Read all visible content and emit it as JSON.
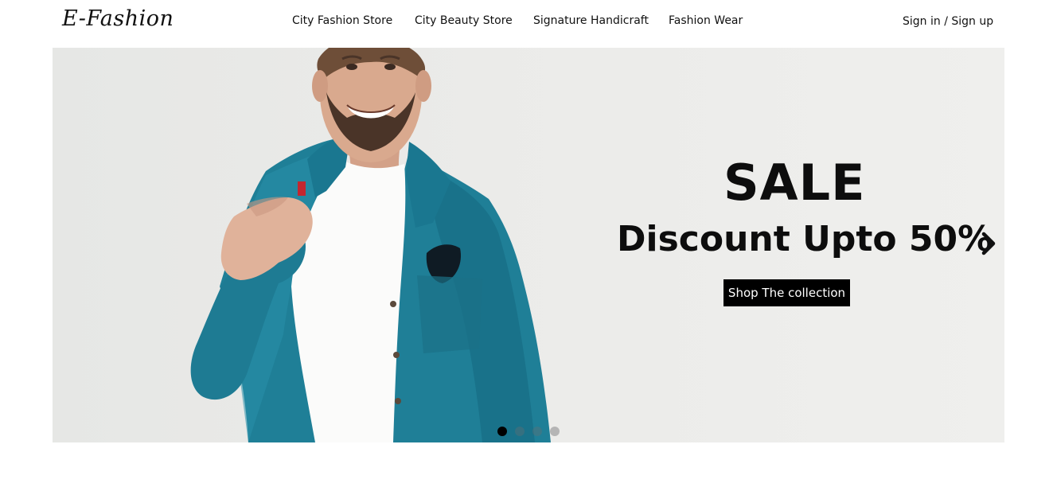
{
  "header": {
    "logo": "E-Fashion",
    "nav": [
      {
        "label": "City Fashion Store"
      },
      {
        "label": "City Beauty Store"
      },
      {
        "label": "Signature Handicraft"
      },
      {
        "label": "Fashion Wear"
      }
    ],
    "auth_label": "Sign in / Sign up"
  },
  "hero": {
    "headline": "SALE",
    "subheadline": "Discount Upto 50%",
    "cta_label": "Shop The collection",
    "next_icon": "chevron-right-icon",
    "slide_count": 4,
    "active_slide": 1
  },
  "colors": {
    "background": "#ffffff",
    "hero_background": "#e9eae8",
    "text": "#111111",
    "cta_background": "#000000",
    "cta_text": "#ffffff",
    "denim": "#1f7f97",
    "dot_active": "#000000",
    "dot_inactive": "#b5b5b5"
  }
}
